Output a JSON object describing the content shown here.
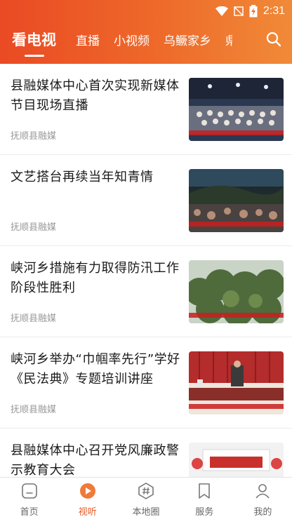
{
  "status_bar": {
    "time": "2:31",
    "battery_level": "charging"
  },
  "header": {
    "tabs": [
      {
        "label": "看电视",
        "active": true
      },
      {
        "label": "直播"
      },
      {
        "label": "小视频"
      },
      {
        "label": "乌鳜家乡"
      },
      {
        "label": "県"
      }
    ],
    "search_icon": "search-icon"
  },
  "news": [
    {
      "title": "县融媒体中心首次实现新媒体节目现场直播",
      "source": "抚顺县融媒"
    },
    {
      "title": "文艺搭台再续当年知青情",
      "source": "抚顺县融媒"
    },
    {
      "title": "峡河乡措施有力取得防汛工作阶段性胜利",
      "source": "抚顺县融媒"
    },
    {
      "title": "峡河乡举办“巾帼率先行”学好《民法典》专题培训讲座",
      "source": "抚顺县融媒"
    },
    {
      "title": "县融媒体中心召开党风廉政警示教育大会",
      "source": ""
    }
  ],
  "bottom_nav": [
    {
      "label": "首页",
      "icon": "home-icon"
    },
    {
      "label": "视听",
      "icon": "play-icon",
      "active": true
    },
    {
      "label": "本地圈",
      "icon": "hashtag-icon"
    },
    {
      "label": "服务",
      "icon": "bookmark-icon"
    },
    {
      "label": "我的",
      "icon": "user-icon"
    }
  ],
  "colors": {
    "header_start": "#ea4a24",
    "header_end": "#f08a38",
    "active_nav": "#ea5a25"
  }
}
